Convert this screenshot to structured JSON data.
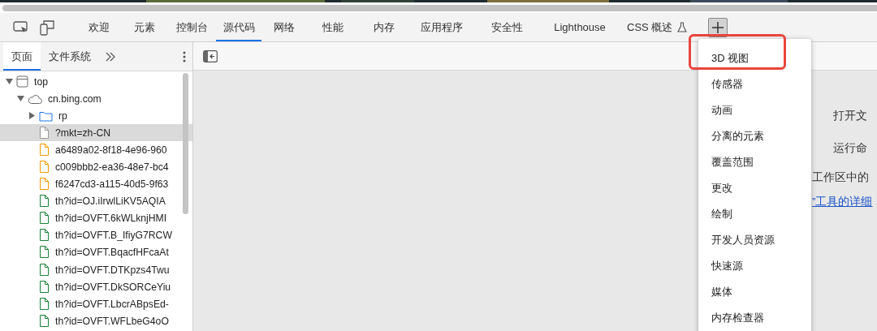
{
  "tabs": [
    {
      "label": "欢迎",
      "selected": false
    },
    {
      "label": "元素",
      "selected": false
    },
    {
      "label": "控制台",
      "selected": false
    },
    {
      "label": "源代码",
      "selected": true
    },
    {
      "label": "网络",
      "selected": false
    },
    {
      "label": "性能",
      "selected": false
    },
    {
      "label": "内存",
      "selected": false
    },
    {
      "label": "应用程序",
      "selected": false
    },
    {
      "label": "安全性",
      "selected": false
    },
    {
      "label": "Lighthouse",
      "selected": false
    },
    {
      "label": "CSS 概述",
      "selected": false,
      "kind": "experiment"
    }
  ],
  "navigator": {
    "tabs": [
      {
        "label": "页面",
        "selected": true
      },
      {
        "label": "文件系统",
        "selected": false
      }
    ],
    "tree": [
      {
        "label": "top",
        "kind": "frame",
        "expanded": true,
        "selected": false,
        "children": [
          {
            "label": "cn.bing.com",
            "kind": "domain",
            "expanded": true,
            "selected": false,
            "children": [
              {
                "label": "rp",
                "kind": "folder",
                "expanded": false,
                "selected": false
              },
              {
                "label": "?mkt=zh-CN",
                "kind": "document",
                "selected": true
              },
              {
                "label": "a6489a02-8f18-4e96-960",
                "kind": "script",
                "selected": false
              },
              {
                "label": "c009bbb2-ea36-48e7-bc4",
                "kind": "script",
                "selected": false
              },
              {
                "label": "f6247cd3-a115-40d5-9f63",
                "kind": "script",
                "selected": false
              },
              {
                "label": "th?id=OJ.iIrwlLiKV5AQIA",
                "selected": false
              },
              {
                "label": "th?id=OVFT.6kWLknjHMI",
                "selected": false
              },
              {
                "label": "th?id=OVFT.B_IfiyG7RCW",
                "selected": false
              },
              {
                "label": "th?id=OVFT.BqacfHFcaAt",
                "selected": false
              },
              {
                "label": "th?id=OVFT.DTKpzs4Twu",
                "selected": false
              },
              {
                "label": "th?id=OVFT.DkSORCeYiu",
                "selected": false
              },
              {
                "label": "th?id=OVFT.LbcrABpsEd-",
                "selected": false
              },
              {
                "label": "th?id=OVFT.WFLbeG4oO",
                "selected": false
              }
            ]
          }
        ]
      }
    ]
  },
  "editor": {
    "lines": [
      {
        "kind": "shortcut",
        "text": "打开文"
      },
      {
        "kind": "shortcut",
        "text": "运行命"
      },
      {
        "kind": "text",
        "text": "工作区中的"
      },
      {
        "kind": "link",
        "text": "”工具的详细"
      }
    ]
  },
  "more_tools_menu": {
    "items": [
      {
        "label": "3D 视图",
        "highlighted": true
      },
      {
        "label": "传感器",
        "highlighted": false
      },
      {
        "label": "动画",
        "highlighted": false
      },
      {
        "label": "分离的元素",
        "highlighted": false
      },
      {
        "label": "覆盖范围",
        "highlighted": false
      },
      {
        "label": "更改",
        "highlighted": false
      },
      {
        "label": "绘制",
        "highlighted": false
      },
      {
        "label": "开发人员资源",
        "highlighted": false
      },
      {
        "label": "快速源",
        "highlighted": false
      },
      {
        "label": "媒体",
        "highlighted": false
      },
      {
        "label": "内存检查器",
        "highlighted": false
      }
    ]
  }
}
